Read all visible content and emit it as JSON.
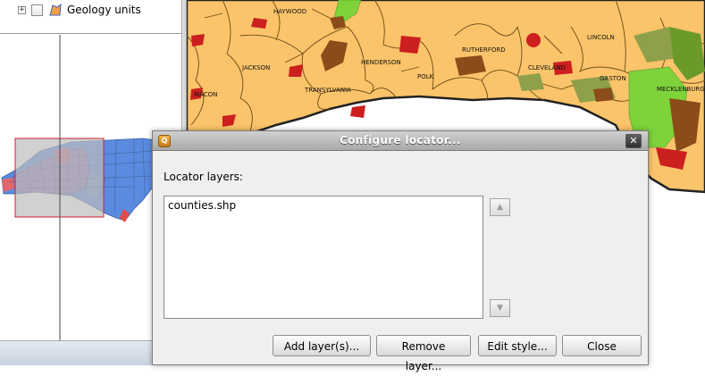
{
  "layer_tree": {
    "items": [
      {
        "label": "Geology units",
        "expander": "+"
      }
    ]
  },
  "map": {
    "county_labels": [
      "HAYWOOD",
      "RUTHERFORD",
      "LINCOLN",
      "JACKSON",
      "HENDERSON",
      "POLK",
      "CLEVELAND",
      "GASTON",
      "MECKLENBURG",
      "TRANSYLVANIA",
      "MACON"
    ]
  },
  "dialog": {
    "title": "Configure locator...",
    "close_glyph": "✕",
    "app_icon_glyph": "Q",
    "locator_label": "Locator layers:",
    "layers": [
      "counties.shp"
    ],
    "move_up_glyph": "▲",
    "move_down_glyph": "▼",
    "buttons": {
      "add": "Add layer(s)...",
      "remove": "Remove layer...",
      "edit": "Edit style...",
      "close": "Close"
    }
  },
  "colors": {
    "county_fill": "#fbc46a",
    "county_border": "#7a5a1a",
    "dialog_title_text": "#ffffff",
    "urban_red": "#cc1f1f",
    "urban_brown": "#8b4c1a",
    "urban_green": "#7ed23a"
  }
}
